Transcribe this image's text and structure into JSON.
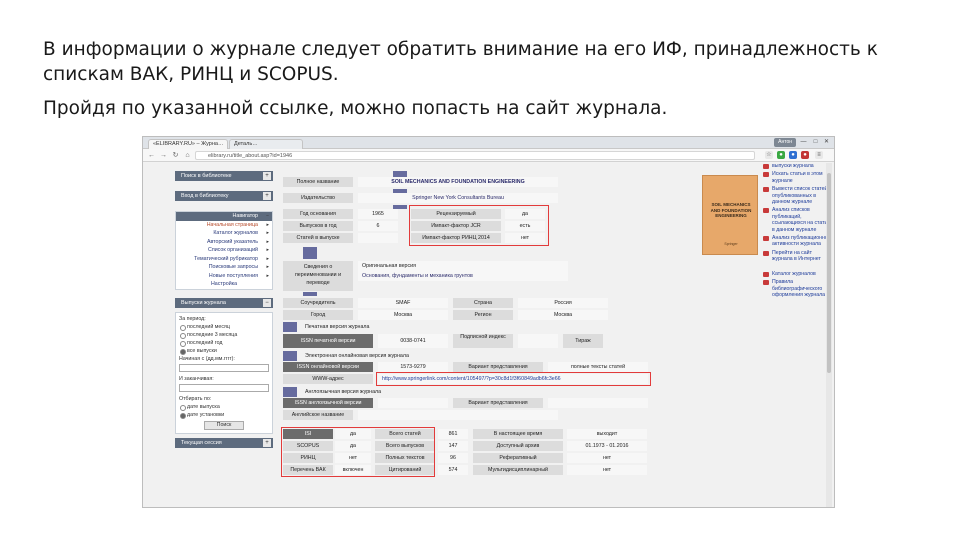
{
  "slide": {
    "para1": "В информации о журнале следует обратить внимание на его ИФ, принадлежность к спискам ВАК, РИНЦ и SCOPUS.",
    "para2": "Пройдя по указанной ссылке, можно попасть на сайт журнала."
  },
  "browser": {
    "tab1": "«ELIBRARY.RU» – Журна…",
    "tab2": "Деталь…",
    "user": "Антон",
    "url": "elibrary.ru/title_about.asp?id=1946",
    "close_glyph": "✕",
    "min_glyph": "—",
    "max_glyph": "□"
  },
  "left": {
    "search_lib": "Поиск в библиотеке",
    "enter_lib": "Вход в библиотеку",
    "menu_header": "Навигатор",
    "menu": [
      "Начальная страница",
      "Каталог журналов",
      "Авторский указатель",
      "Список организаций",
      "Тематический рубрикатор",
      "Поисковые запросы",
      "Новые поступления",
      "Настройка"
    ],
    "issues_bar": "Выпуски журнала",
    "period_label": "За период:",
    "periods": [
      "последний месяц",
      "последние 3 месяца",
      "последний год",
      "все выпуски"
    ],
    "year_label": "Начиная с (дд.мм.гггг):",
    "till_label": "И заканчивая:",
    "sort_label": "Отбирать по:",
    "sort_opts": [
      "дате выпуска",
      "дате установки"
    ],
    "search_btn": "Поиск",
    "session_bar": "Текущая сессия"
  },
  "main": {
    "full_name_label": "Полное название",
    "full_name": "SOIL MECHANICS AND FOUNDATION ENGINEERING",
    "publisher_label": "Издательство",
    "publisher": "Springer New York Consultants Bureau",
    "founded_label": "Год основания",
    "founded": "1965",
    "issues_label": "Выпусков в год",
    "issues": "6",
    "articles_label": "Статей в выпуске",
    "peer_label": "Рецензируемый",
    "peer": "да",
    "jcr_label": "Импакт-фактор JCR",
    "jcr": "есть",
    "rinc_if_label": "Импакт-фактор РИНЦ 2014",
    "rinc_if": "нет",
    "orig_label": "Сведения о переименовании и переводе",
    "orig_title": "Оригинальная версия",
    "orig_name": "Основания, фундаменты и механика грунтов",
    "founders_label": "Соучредитель",
    "founder": "SMAF",
    "country_label": "Страна",
    "country": "Россия",
    "city_label": "Город",
    "city": "Москва",
    "region_label": "Регион",
    "region": "Москва",
    "print_header": "Печатная версия журнала",
    "issn_print_label": "ISSN печатной версии",
    "issn_print": "0038-0741",
    "subscr_label": "Подписной индекс",
    "tirazh_label": "Тираж",
    "online_header": "Электронная онлайновая версия журнала",
    "issn_online_label": "ISSN онлайновой версии",
    "issn_online": "1573-9279",
    "present_label": "Вариант представления",
    "present": "полные тексты статей",
    "www_label": "WWW-адрес",
    "www": "http://www.springerlink.com/content/105497/?p=30c8d1f3f60849adb6fc3e66",
    "eng_header": "Англоязычная версия журнала",
    "issn_eng_label": "ISSN англоязычной версии",
    "variant_label": "Вариант представления",
    "eng_name_label": "Английское название",
    "idx": [
      {
        "name": "ISI",
        "val": "да"
      },
      {
        "name": "SCOPUS",
        "val": "да"
      },
      {
        "name": "РИНЦ",
        "val": "нет"
      },
      {
        "name": "Перечень ВАК",
        "val": "включен"
      }
    ],
    "stats": [
      {
        "label": "Всего статей",
        "val": "861",
        "label2": "В настоящее время",
        "val2": "выходит"
      },
      {
        "label": "Всего выпусков",
        "val": "147",
        "label2": "Доступный архив",
        "val2": "01.1973 - 01.2016"
      },
      {
        "label": "Полных текстов",
        "val": "96",
        "label2": "Реферативный",
        "val2": "нет"
      },
      {
        "label": "Цитирований",
        "val": "574",
        "label2": "Мультидисциплинарный",
        "val2": "нет"
      }
    ]
  },
  "cover": {
    "title": "SOIL MECHANICS AND FOUNDATION ENGINEERING",
    "sub": "Springer"
  },
  "right": {
    "items": [
      "выпуски журнала",
      "Искать статьи в этом журнале",
      "Вывести список статей, опубликованных в данном журнале",
      "Анализ списков публикаций, ссылающихся на статьи в данном журнале",
      "Анализ публикационной активности журнала",
      "Перейти на сайт журнала в Интернет",
      "Каталог журналов",
      "Правила библиографического оформления журнала"
    ]
  }
}
